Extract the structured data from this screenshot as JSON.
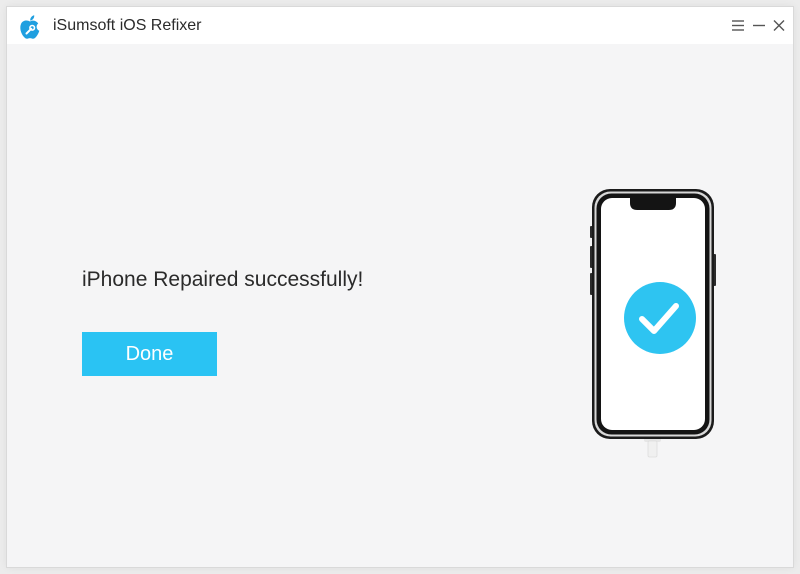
{
  "window": {
    "title": "iSumsoft iOS Refixer",
    "controls": {
      "menu_icon": "hamburger-menu-icon",
      "minimize_icon": "minimize-icon",
      "close_icon": "close-icon"
    }
  },
  "main": {
    "message": "iPhone Repaired successfully!",
    "done_label": "Done"
  },
  "illustration": {
    "device": "iphone",
    "status_icon": "check-icon"
  },
  "colors": {
    "accent": "#2ac3f3",
    "check_circle": "#2ec4f1",
    "window_bg": "#f5f5f6",
    "titlebar_bg": "#ffffff",
    "text": "#2a2a2a"
  }
}
